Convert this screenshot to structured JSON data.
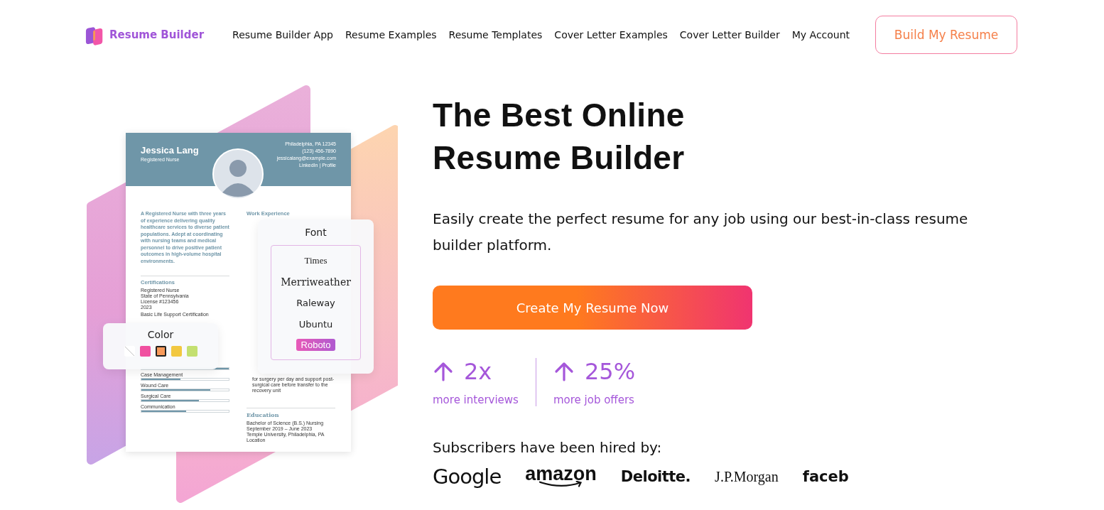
{
  "nav": {
    "logo": "Resume Builder",
    "links": [
      "Resume Builder App",
      "Resume Examples",
      "Resume Templates",
      "Cover Letter Examples",
      "Cover Letter Builder",
      "My Account"
    ],
    "cta": "Build My Resume"
  },
  "illustration": {
    "resume": {
      "name": "Jessica Lang",
      "role": "Registered Nurse",
      "contact": [
        "Philadelphia, PA 12345",
        "(123) 456-7890",
        "jessicalang@example.com",
        "LinkedIn | Profile"
      ],
      "summary": "A Registered Nurse with three years of experience delivering quality healthcare services to diverse patient populations. Adept at coordinating with nursing teams and medical personnel to drive positive patient outcomes in high-volume hospital environments.",
      "certifications_title": "Certifications",
      "certifications": [
        "Registered Nurse",
        "State of Pennsylvania",
        "License #123456",
        "2023"
      ],
      "certification_extra": "Basic Life Support Certification",
      "skills": [
        {
          "level": 1
        },
        {
          "name": "Case Management",
          "level": 0.45
        },
        {
          "name": "Wound Care",
          "level": 0.79
        },
        {
          "name": "Surgical Care",
          "level": 0.66
        },
        {
          "name": "Communication",
          "level": 0.51
        }
      ],
      "work_title": "Work Experience",
      "work_lines": [
        "for surgery per day and support post-",
        "surgical care before transfer to the",
        "recovery unit"
      ],
      "education_title": "Education",
      "education": [
        "Bachelor of Science (B.S.) Nursing",
        "September 2019 – June 2023",
        "Temple University, Philadelphia, PA",
        "Location"
      ]
    },
    "font_panel": {
      "title": "Font",
      "options": [
        {
          "label": "Times",
          "kind": "times",
          "selected": false
        },
        {
          "label": "Merriweather",
          "kind": "merriweather",
          "selected": false
        },
        {
          "label": "Raleway",
          "kind": "raleway",
          "selected": false
        },
        {
          "label": "Ubuntu",
          "kind": "ubuntu",
          "selected": false
        },
        {
          "label": "Roboto",
          "kind": "roboto",
          "selected": true
        }
      ]
    },
    "color_panel": {
      "title": "Color",
      "swatches": [
        {
          "kind": "none",
          "color": "#ffffff",
          "selected": false
        },
        {
          "kind": "fill",
          "color": "#f050a0",
          "selected": false
        },
        {
          "kind": "fill",
          "color": "#f89a5a",
          "selected": true
        },
        {
          "kind": "fill",
          "color": "#f2c840",
          "selected": false
        },
        {
          "kind": "fill",
          "color": "#c4e070",
          "selected": false
        }
      ]
    }
  },
  "hero": {
    "title": [
      "The Best Online",
      "Resume Builder"
    ],
    "subtitle": "Easily create the perfect resume for any job using our best-in-class resume builder platform.",
    "cta": "Create My Resume Now",
    "stats": [
      {
        "value": "2x",
        "label": "more interviews"
      },
      {
        "value": "25%",
        "label": "more job offers"
      }
    ],
    "hired_label": "Subscribers have been hired by:",
    "companies": [
      {
        "name": "Google",
        "kind": "google"
      },
      {
        "name": "amazon",
        "kind": "amazon"
      },
      {
        "name": "Deloitte.",
        "kind": "deloitte"
      },
      {
        "name": "J.P.Morgan",
        "kind": "jpmorgan"
      },
      {
        "name": "faceb",
        "kind": "facebook"
      }
    ]
  }
}
